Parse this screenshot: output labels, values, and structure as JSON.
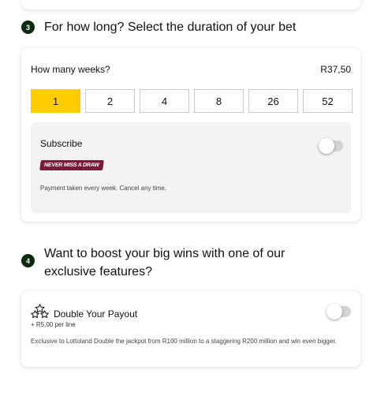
{
  "step3": {
    "number": "3",
    "title": "For how long? Select the duration of your bet"
  },
  "weeks": {
    "label": "How many weeks?",
    "price": "R37,50",
    "options": [
      "1",
      "2",
      "4",
      "8",
      "26",
      "52"
    ],
    "selected": "1"
  },
  "subscribe": {
    "label": "Subscribe",
    "enabled": false,
    "tag": "NEVER MISS A DRAW",
    "note": "Payment taken every week. Cancel any time."
  },
  "step4": {
    "number": "4",
    "title": "Want to boost your big wins with one of our exclusive features?"
  },
  "feature": {
    "icon": "stars-icon",
    "title": "Double Your Payout",
    "price": "+ R5,00 per line",
    "description": "Exclusive to Lottoland Double the jackpot from R100 million to a staggering R200 million and win even bigger.",
    "enabled": false
  },
  "colors": {
    "accent": "#ffcc00",
    "badge": "#0b2a10",
    "tag": "#7a1a3a"
  }
}
